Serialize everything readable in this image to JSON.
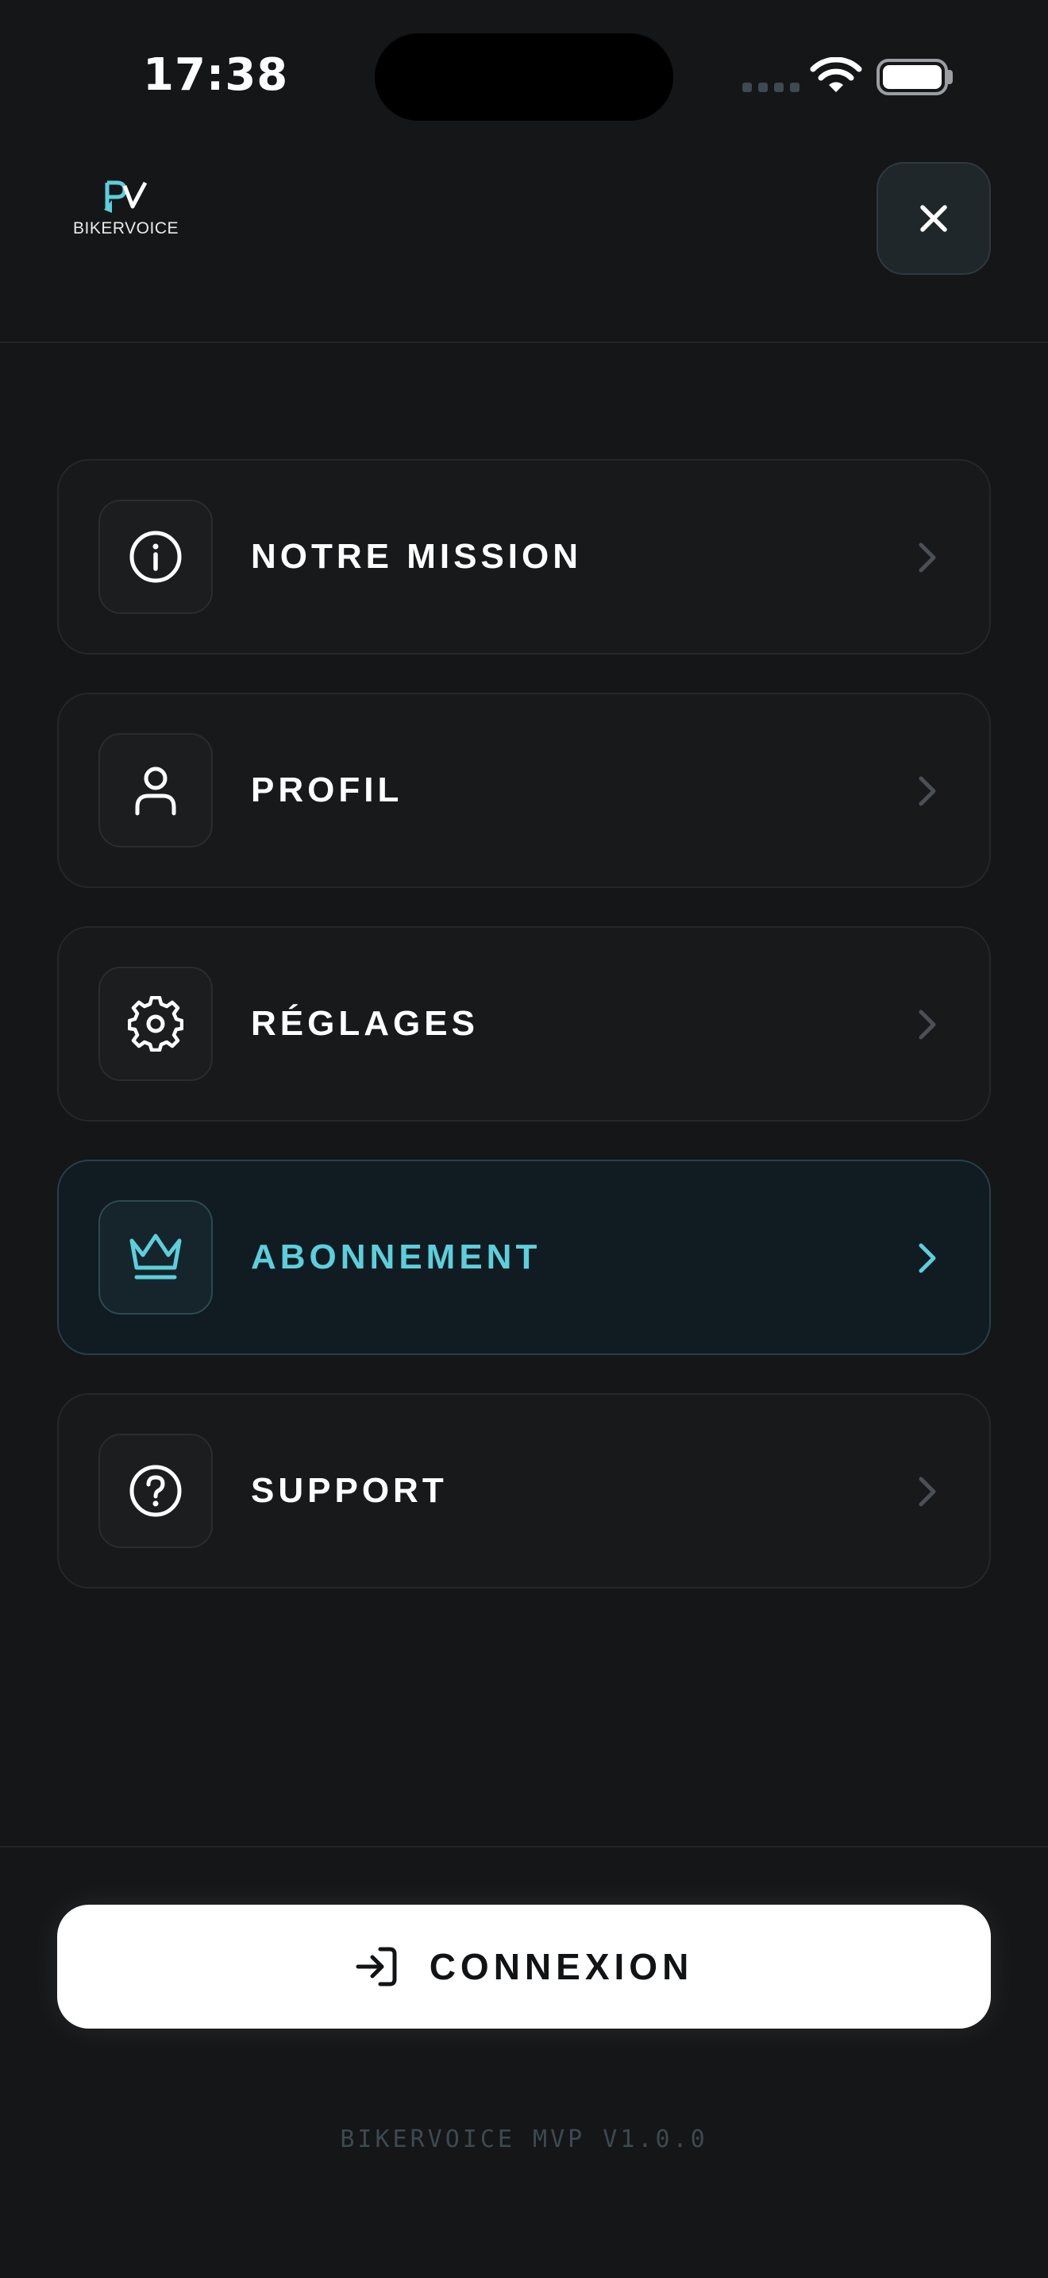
{
  "status_bar": {
    "time": "17:38"
  },
  "header": {
    "logo_text": "BIKERVOICE",
    "brand_color": "#5ccfdc",
    "close_icon": "close-icon"
  },
  "menu": {
    "items": [
      {
        "label": "NOTRE MISSION",
        "icon": "info-icon",
        "active": false
      },
      {
        "label": "PROFIL",
        "icon": "user-icon",
        "active": false
      },
      {
        "label": "RÉGLAGES",
        "icon": "gear-icon",
        "active": false
      },
      {
        "label": "ABONNEMENT",
        "icon": "crown-icon",
        "active": true
      },
      {
        "label": "SUPPORT",
        "icon": "help-circle-icon",
        "active": false
      }
    ]
  },
  "footer": {
    "login_label": "CONNEXION",
    "login_icon": "sign-in-icon",
    "version": "BIKERVOICE MVP V1.0.0"
  }
}
